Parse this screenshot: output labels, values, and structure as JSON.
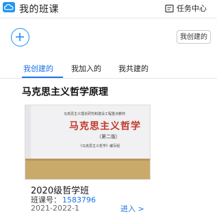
{
  "header": {
    "title": "我的班课",
    "task_center_label": "任务中心",
    "logo_icon": "cloud-logo-icon",
    "task_icon": "task-center-icon",
    "brand_color": "#2196f3"
  },
  "toolbar": {
    "add_icon": "plus-circle-icon",
    "created_pill_label": "我创建的"
  },
  "tabs": [
    {
      "label": "我创建的",
      "active": true
    },
    {
      "label": "我加入的",
      "active": false
    },
    {
      "label": "我共建的",
      "active": false
    }
  ],
  "section": {
    "title": "马克思主义哲学原理"
  },
  "course_card": {
    "cover": {
      "series": "马克思主义理论研究和建设工程重点教材",
      "title": "马克思主义哲学",
      "edition": "（第二版）",
      "author": "《马克思主义哲学》编写组"
    },
    "class_name": "2020级哲学班",
    "code_label": "班课号：",
    "code_value": "1583796",
    "term": "2021-2022-1",
    "enter_label": "进入 >"
  },
  "accent_color": "#1a73e8"
}
